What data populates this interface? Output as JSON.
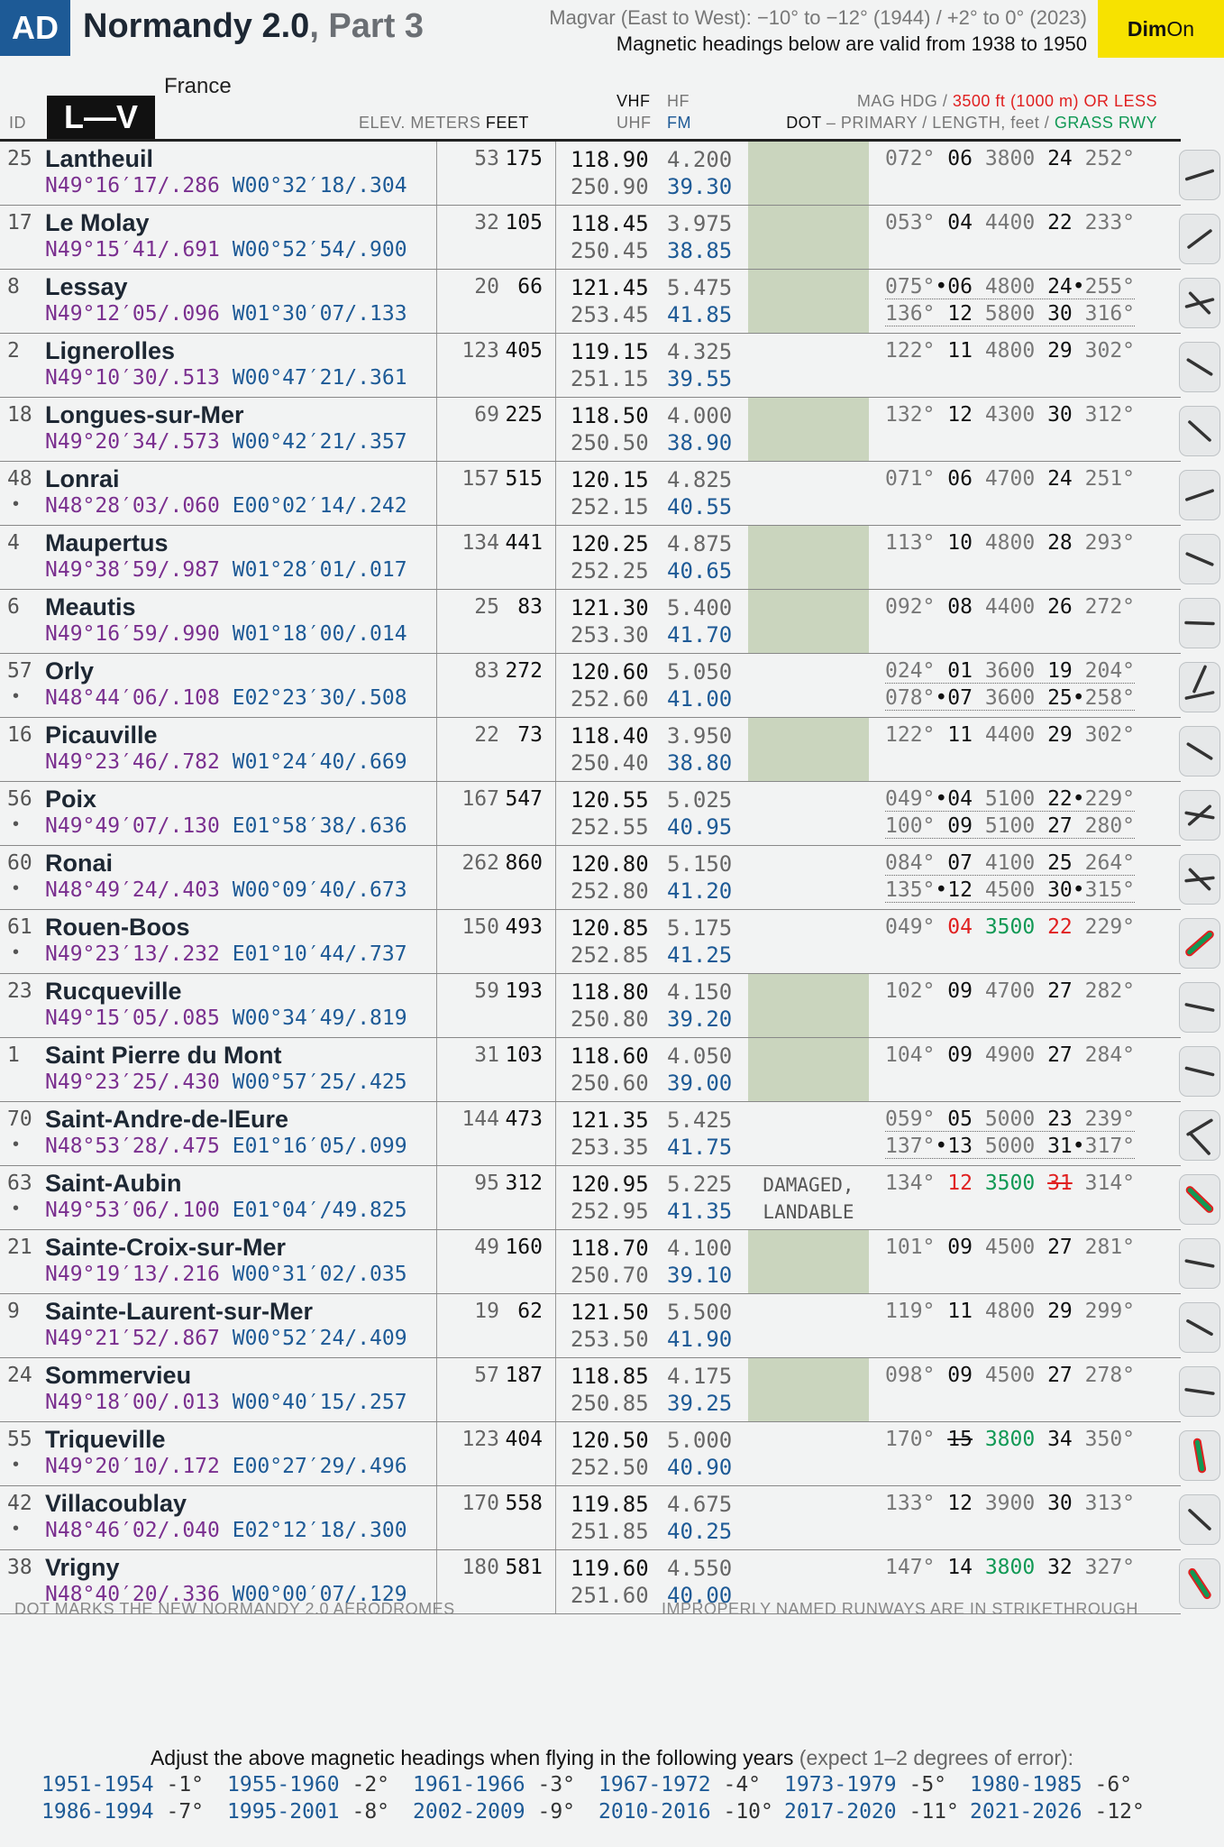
{
  "header": {
    "badge": "AD",
    "title_main": "Normandy 2.0",
    "title_part": ", Part 3",
    "magvar_line1": "Magvar (East to West): −10° to −12° (1944) / +2° to 0° (2023)",
    "magvar_line2": "Magnetic headings below are valid from 1938 to 1950",
    "dim_bold": "Dim",
    "dim_normal": "On",
    "accent_color": "#1d5a96",
    "dim_color": "#f7e200"
  },
  "columns": {
    "id": "ID",
    "section": "L—V",
    "country": "France",
    "elev_meters": "ELEV. METERS",
    "elev_feet": "FEET",
    "vhf": "VHF",
    "hf": "HF",
    "uhf": "UHF",
    "fm": "FM",
    "mag_hdg": "MAG HDG /",
    "limit": "3500 ft (1000 m) OR LESS",
    "dot": "DOT",
    "primary": "– PRIMARY / LENGTH, feet /",
    "grass": "GRASS RWY"
  },
  "rows": [
    {
      "id": "25",
      "dot": "",
      "name": "Lantheuil",
      "lat": "N49°16′17/.286",
      "lon": "W00°32′18/.304",
      "elev_m": "53",
      "elev_ft": "175",
      "vhf": "118.90",
      "hf": "4.200",
      "uhf": "250.90",
      "fm": "39.30",
      "green": true,
      "remark": "",
      "runways": [
        {
          "hdg": "072°",
          "sep": " ",
          "n1": "06",
          "len": "3800",
          "n2": "24",
          "sep2": " ",
          "hdg2": "252°"
        }
      ],
      "icon": "single-runway-icon"
    },
    {
      "id": "17",
      "dot": "",
      "name": "Le Molay",
      "lat": "N49°15′41/.691",
      "lon": "W00°52′54/.900",
      "elev_m": "32",
      "elev_ft": "105",
      "vhf": "118.45",
      "hf": "3.975",
      "uhf": "250.45",
      "fm": "38.85",
      "green": true,
      "remark": "",
      "runways": [
        {
          "hdg": "053°",
          "sep": " ",
          "n1": "04",
          "len": "4400",
          "n2": "22",
          "sep2": " ",
          "hdg2": "233°"
        }
      ],
      "icon": "single-runway-icon"
    },
    {
      "id": "8",
      "dot": "",
      "name": "Lessay",
      "lat": "N49°12′05/.096",
      "lon": "W01°30′07/.133",
      "elev_m": "20",
      "elev_ft": "66",
      "vhf": "121.45",
      "hf": "5.475",
      "uhf": "253.45",
      "fm": "41.85",
      "green": true,
      "remark": "",
      "runways": [
        {
          "hdg": "075°",
          "sep": "•",
          "n1": "06",
          "len": "4800",
          "n2": "24",
          "sep2": "•",
          "hdg2": "255°"
        },
        {
          "hdg": "136°",
          "sep": " ",
          "n1": "12",
          "len": "5800",
          "n2": "30",
          "sep2": " ",
          "hdg2": "316°"
        }
      ],
      "icon": "crossing-runways-icon"
    },
    {
      "id": "2",
      "dot": "",
      "name": "Lignerolles",
      "lat": "N49°10′30/.513",
      "lon": "W00°47′21/.361",
      "elev_m": "123",
      "elev_ft": "405",
      "vhf": "119.15",
      "hf": "4.325",
      "uhf": "251.15",
      "fm": "39.55",
      "green": false,
      "remark": "",
      "runways": [
        {
          "hdg": "122°",
          "sep": " ",
          "n1": "11",
          "len": "4800",
          "n2": "29",
          "sep2": " ",
          "hdg2": "302°"
        }
      ],
      "icon": "single-runway-icon"
    },
    {
      "id": "18",
      "dot": "",
      "name": "Longues-sur-Mer",
      "lat": "N49°20′34/.573",
      "lon": "W00°42′21/.357",
      "elev_m": "69",
      "elev_ft": "225",
      "vhf": "118.50",
      "hf": "4.000",
      "uhf": "250.50",
      "fm": "38.90",
      "green": true,
      "remark": "",
      "runways": [
        {
          "hdg": "132°",
          "sep": " ",
          "n1": "12",
          "len": "4300",
          "n2": "30",
          "sep2": " ",
          "hdg2": "312°"
        }
      ],
      "icon": "single-runway-icon"
    },
    {
      "id": "48",
      "dot": "•",
      "name": "Lonrai",
      "lat": "N48°28′03/.060",
      "lon": "E00°02′14/.242",
      "elev_m": "157",
      "elev_ft": "515",
      "vhf": "120.15",
      "hf": "4.825",
      "uhf": "252.15",
      "fm": "40.55",
      "green": false,
      "remark": "",
      "runways": [
        {
          "hdg": "071°",
          "sep": " ",
          "n1": "06",
          "len": "4700",
          "n2": "24",
          "sep2": " ",
          "hdg2": "251°"
        }
      ],
      "icon": "single-runway-icon"
    },
    {
      "id": "4",
      "dot": "",
      "name": "Maupertus",
      "lat": "N49°38′59/.987",
      "lon": "W01°28′01/.017",
      "elev_m": "134",
      "elev_ft": "441",
      "vhf": "120.25",
      "hf": "4.875",
      "uhf": "252.25",
      "fm": "40.65",
      "green": true,
      "remark": "",
      "runways": [
        {
          "hdg": "113°",
          "sep": " ",
          "n1": "10",
          "len": "4800",
          "n2": "28",
          "sep2": " ",
          "hdg2": "293°"
        }
      ],
      "icon": "single-runway-icon"
    },
    {
      "id": "6",
      "dot": "",
      "name": "Meautis",
      "lat": "N49°16′59/.990",
      "lon": "W01°18′00/.014",
      "elev_m": "25",
      "elev_ft": "83",
      "vhf": "121.30",
      "hf": "5.400",
      "uhf": "253.30",
      "fm": "41.70",
      "green": true,
      "remark": "",
      "runways": [
        {
          "hdg": "092°",
          "sep": " ",
          "n1": "08",
          "len": "4400",
          "n2": "26",
          "sep2": " ",
          "hdg2": "272°"
        }
      ],
      "icon": "single-runway-icon"
    },
    {
      "id": "57",
      "dot": "•",
      "name": "Orly",
      "lat": "N48°44′06/.108",
      "lon": "E02°23′30/.508",
      "elev_m": "83",
      "elev_ft": "272",
      "vhf": "120.60",
      "hf": "5.050",
      "uhf": "252.60",
      "fm": "41.00",
      "green": false,
      "remark": "",
      "runways": [
        {
          "hdg": "024°",
          "sep": " ",
          "n1": "01",
          "len": "3600",
          "n2": "19",
          "sep2": " ",
          "hdg2": "204°"
        },
        {
          "hdg": "078°",
          "sep": "•",
          "n1": "07",
          "len": "3600",
          "n2": "25",
          "sep2": "•",
          "hdg2": "258°"
        }
      ],
      "icon": "two-runways-icon"
    },
    {
      "id": "16",
      "dot": "",
      "name": "Picauville",
      "lat": "N49°23′46/.782",
      "lon": "W01°24′40/.669",
      "elev_m": "22",
      "elev_ft": "73",
      "vhf": "118.40",
      "hf": "3.950",
      "uhf": "250.40",
      "fm": "38.80",
      "green": true,
      "remark": "",
      "runways": [
        {
          "hdg": "122°",
          "sep": " ",
          "n1": "11",
          "len": "4400",
          "n2": "29",
          "sep2": " ",
          "hdg2": "302°"
        }
      ],
      "icon": "single-runway-icon"
    },
    {
      "id": "56",
      "dot": "•",
      "name": "Poix",
      "lat": "N49°49′07/.130",
      "lon": "E01°58′38/.636",
      "elev_m": "167",
      "elev_ft": "547",
      "vhf": "120.55",
      "hf": "5.025",
      "uhf": "252.55",
      "fm": "40.95",
      "green": false,
      "remark": "",
      "runways": [
        {
          "hdg": "049°",
          "sep": "•",
          "n1": "04",
          "len": "5100",
          "n2": "22",
          "sep2": "•",
          "hdg2": "229°"
        },
        {
          "hdg": "100°",
          "sep": " ",
          "n1": "09",
          "len": "5100",
          "n2": "27",
          "sep2": " ",
          "hdg2": "280°"
        }
      ],
      "icon": "crossing-runways-icon"
    },
    {
      "id": "60",
      "dot": "•",
      "name": "Ronai",
      "lat": "N48°49′24/.403",
      "lon": "W00°09′40/.673",
      "elev_m": "262",
      "elev_ft": "860",
      "vhf": "120.80",
      "hf": "5.150",
      "uhf": "252.80",
      "fm": "41.20",
      "green": false,
      "remark": "",
      "runways": [
        {
          "hdg": "084°",
          "sep": " ",
          "n1": "07",
          "len": "4100",
          "n2": "25",
          "sep2": " ",
          "hdg2": "264°"
        },
        {
          "hdg": "135°",
          "sep": "•",
          "n1": "12",
          "len": "4500",
          "n2": "30",
          "sep2": "•",
          "hdg2": "315°"
        }
      ],
      "icon": "crossing-runways-icon"
    },
    {
      "id": "61",
      "dot": "•",
      "name": "Rouen-Boos",
      "lat": "N49°23′13/.232",
      "lon": "E01°10′44/.737",
      "elev_m": "150",
      "elev_ft": "493",
      "vhf": "120.85",
      "hf": "5.175",
      "uhf": "252.85",
      "fm": "41.25",
      "green": false,
      "remark": "",
      "runways": [
        {
          "hdg": "049°",
          "sep": " ",
          "n1": "04",
          "n1_color": "red",
          "len": "3500",
          "len_color": "green",
          "n2": "22",
          "n2_color": "red",
          "sep2": " ",
          "hdg2": "229°"
        }
      ],
      "icon": "grass-runway-icon"
    },
    {
      "id": "23",
      "dot": "",
      "name": "Rucqueville",
      "lat": "N49°15′05/.085",
      "lon": "W00°34′49/.819",
      "elev_m": "59",
      "elev_ft": "193",
      "vhf": "118.80",
      "hf": "4.150",
      "uhf": "250.80",
      "fm": "39.20",
      "green": true,
      "remark": "",
      "runways": [
        {
          "hdg": "102°",
          "sep": " ",
          "n1": "09",
          "len": "4700",
          "n2": "27",
          "sep2": " ",
          "hdg2": "282°"
        }
      ],
      "icon": "single-runway-icon"
    },
    {
      "id": "1",
      "dot": "",
      "name": "Saint Pierre du Mont",
      "lat": "N49°23′25/.430",
      "lon": "W00°57′25/.425",
      "elev_m": "31",
      "elev_ft": "103",
      "vhf": "118.60",
      "hf": "4.050",
      "uhf": "250.60",
      "fm": "39.00",
      "green": true,
      "remark": "",
      "runways": [
        {
          "hdg": "104°",
          "sep": " ",
          "n1": "09",
          "len": "4900",
          "n2": "27",
          "sep2": " ",
          "hdg2": "284°"
        }
      ],
      "icon": "single-runway-icon"
    },
    {
      "id": "70",
      "dot": "•",
      "name": "Saint-Andre-de-lEure",
      "lat": "N48°53′28/.475",
      "lon": "E01°16′05/.099",
      "elev_m": "144",
      "elev_ft": "473",
      "vhf": "121.35",
      "hf": "5.425",
      "uhf": "253.35",
      "fm": "41.75",
      "green": false,
      "remark": "",
      "runways": [
        {
          "hdg": "059°",
          "sep": " ",
          "n1": "05",
          "len": "5000",
          "n2": "23",
          "sep2": " ",
          "hdg2": "239°"
        },
        {
          "hdg": "137°",
          "sep": "•",
          "n1": "13",
          "len": "5000",
          "n2": "31",
          "sep2": "•",
          "hdg2": "317°"
        }
      ],
      "icon": "two-runways-icon"
    },
    {
      "id": "63",
      "dot": "•",
      "name": "Saint-Aubin",
      "lat": "N49°53′06/.100",
      "lon": "E01°04′/49.825",
      "elev_m": "95",
      "elev_ft": "312",
      "vhf": "120.95",
      "hf": "5.225",
      "uhf": "252.95",
      "fm": "41.35",
      "green": false,
      "remark": "DAMAGED, LANDABLE",
      "runways": [
        {
          "hdg": "134°",
          "sep": " ",
          "n1": "12",
          "n1_color": "red",
          "len": "3500",
          "len_color": "green",
          "n2": "31",
          "n2_color": "red",
          "n2_strike": true,
          "sep2": " ",
          "hdg2": "314°"
        }
      ],
      "icon": "grass-runway-icon"
    },
    {
      "id": "21",
      "dot": "",
      "name": "Sainte-Croix-sur-Mer",
      "lat": "N49°19′13/.216",
      "lon": "W00°31′02/.035",
      "elev_m": "49",
      "elev_ft": "160",
      "vhf": "118.70",
      "hf": "4.100",
      "uhf": "250.70",
      "fm": "39.10",
      "green": true,
      "remark": "",
      "runways": [
        {
          "hdg": "101°",
          "sep": " ",
          "n1": "09",
          "len": "4500",
          "n2": "27",
          "sep2": " ",
          "hdg2": "281°"
        }
      ],
      "icon": "single-runway-icon"
    },
    {
      "id": "9",
      "dot": "",
      "name": "Sainte-Laurent-sur-Mer",
      "lat": "N49°21′52/.867",
      "lon": "W00°52′24/.409",
      "elev_m": "19",
      "elev_ft": "62",
      "vhf": "121.50",
      "hf": "5.500",
      "uhf": "253.50",
      "fm": "41.90",
      "green": false,
      "remark": "",
      "runways": [
        {
          "hdg": "119°",
          "sep": " ",
          "n1": "11",
          "len": "4800",
          "n2": "29",
          "sep2": " ",
          "hdg2": "299°"
        }
      ],
      "icon": "single-runway-icon"
    },
    {
      "id": "24",
      "dot": "",
      "name": "Sommervieu",
      "lat": "N49°18′00/.013",
      "lon": "W00°40′15/.257",
      "elev_m": "57",
      "elev_ft": "187",
      "vhf": "118.85",
      "hf": "4.175",
      "uhf": "250.85",
      "fm": "39.25",
      "green": true,
      "remark": "",
      "runways": [
        {
          "hdg": "098°",
          "sep": " ",
          "n1": "09",
          "len": "4500",
          "n2": "27",
          "sep2": " ",
          "hdg2": "278°"
        }
      ],
      "icon": "single-runway-icon"
    },
    {
      "id": "55",
      "dot": "•",
      "name": "Triqueville",
      "lat": "N49°20′10/.172",
      "lon": "E00°27′29/.496",
      "elev_m": "123",
      "elev_ft": "404",
      "vhf": "120.50",
      "hf": "5.000",
      "uhf": "252.50",
      "fm": "40.90",
      "green": false,
      "remark": "",
      "runways": [
        {
          "hdg": "170°",
          "sep": " ",
          "n1": "15",
          "n1_strike": true,
          "len": "3800",
          "len_color": "green",
          "n2": "34",
          "sep2": " ",
          "hdg2": "350°"
        }
      ],
      "icon": "grass-runway-icon"
    },
    {
      "id": "42",
      "dot": "•",
      "name": "Villacoublay",
      "lat": "N48°46′02/.040",
      "lon": "E02°12′18/.300",
      "elev_m": "170",
      "elev_ft": "558",
      "vhf": "119.85",
      "hf": "4.675",
      "uhf": "251.85",
      "fm": "40.25",
      "green": false,
      "remark": "",
      "runways": [
        {
          "hdg": "133°",
          "sep": " ",
          "n1": "12",
          "len": "3900",
          "n2": "30",
          "sep2": " ",
          "hdg2": "313°"
        }
      ],
      "icon": "single-runway-icon"
    },
    {
      "id": "38",
      "dot": "",
      "name": "Vrigny",
      "lat": "N48°40′20/.336",
      "lon": "W00°00′07/.129",
      "elev_m": "180",
      "elev_ft": "581",
      "vhf": "119.60",
      "hf": "4.550",
      "uhf": "251.60",
      "fm": "40.00",
      "green": false,
      "remark": "",
      "runways": [
        {
          "hdg": "147°",
          "sep": " ",
          "n1": "14",
          "len": "3800",
          "len_color": "green",
          "n2": "32",
          "sep2": " ",
          "hdg2": "327°"
        }
      ],
      "icon": "grass-runway-icon"
    }
  ],
  "footer": {
    "left": "DOT MARKS THE NEW NORMANDY 2.0 AERODROMES",
    "right": "IMPROPERLY NAMED RUNWAYS ARE IN STRIKETHROUGH"
  },
  "adjust": {
    "title": "Adjust the above magnetic headings when flying in the following years",
    "subtitle": " (expect 1–2 degrees of error):",
    "years": [
      {
        "range": "1951-1954",
        "val": "-1°"
      },
      {
        "range": "1955-1960",
        "val": "-2°"
      },
      {
        "range": "1961-1966",
        "val": "-3°"
      },
      {
        "range": "1967-1972",
        "val": "-4°"
      },
      {
        "range": "1973-1979",
        "val": "-5°"
      },
      {
        "range": "1980-1985",
        "val": "-6°"
      },
      {
        "range": "1986-1994",
        "val": "-7°"
      },
      {
        "range": "1995-2001",
        "val": "-8°"
      },
      {
        "range": "2002-2009",
        "val": "-9°"
      },
      {
        "range": "2010-2016",
        "val": "-10°"
      },
      {
        "range": "2017-2020",
        "val": "-11°"
      },
      {
        "range": "2021-2026",
        "val": "-12°"
      }
    ]
  }
}
